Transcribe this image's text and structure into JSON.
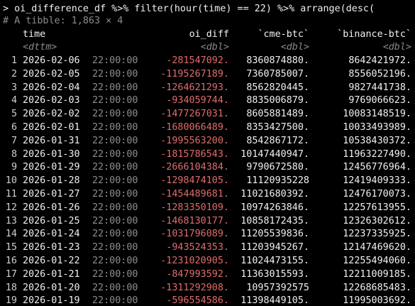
{
  "console": {
    "partial_top_line": "",
    "command": "> oi_difference_df %>% filter(hour(time) == 22) %>% arrange(desc(",
    "tibble_comment": "# A tibble: 1,863 × 4"
  },
  "table": {
    "columns": [
      "time",
      "oi_diff",
      "`cme-btc`",
      "`binance-btc`"
    ],
    "types": [
      "<dttm>",
      "<dbl>",
      "<dbl>",
      "<dbl>"
    ],
    "rows": [
      {
        "n": "1",
        "date": "2026-02-06",
        "time": "22:00:00",
        "oi_diff": "-281547092.",
        "cme": "8360874880.",
        "binance": "8642421972."
      },
      {
        "n": "2",
        "date": "2026-02-05",
        "time": "22:00:00",
        "oi_diff": "-1195267189.",
        "cme": "7360785007.",
        "binance": "8556052196."
      },
      {
        "n": "3",
        "date": "2026-02-04",
        "time": "22:00:00",
        "oi_diff": "-1264621293.",
        "cme": "8562820445.",
        "binance": "9827441738."
      },
      {
        "n": "4",
        "date": "2026-02-03",
        "time": "22:00:00",
        "oi_diff": "-934059744.",
        "cme": "8835006879.",
        "binance": "9769066623."
      },
      {
        "n": "5",
        "date": "2026-02-02",
        "time": "22:00:00",
        "oi_diff": "-1477267031.",
        "cme": "8605881489.",
        "binance": "10083148519."
      },
      {
        "n": "6",
        "date": "2026-02-01",
        "time": "22:00:00",
        "oi_diff": "-1680066489.",
        "cme": "8353427500.",
        "binance": "10033493989."
      },
      {
        "n": "7",
        "date": "2026-01-31",
        "time": "22:00:00",
        "oi_diff": "-1995563200.",
        "cme": "8542867172.",
        "binance": "10538430372."
      },
      {
        "n": "8",
        "date": "2026-01-30",
        "time": "22:00:00",
        "oi_diff": "-1815786543.",
        "cme": "10147440947.",
        "binance": "11963227490."
      },
      {
        "n": "9",
        "date": "2026-01-29",
        "time": "22:00:00",
        "oi_diff": "-2666104384.",
        "cme": "9790672580.",
        "binance": "12456776964."
      },
      {
        "n": "10",
        "date": "2026-01-28",
        "time": "22:00:00",
        "oi_diff": "-1298474105.",
        "cme": "11120935228",
        "binance": "12419409333."
      },
      {
        "n": "11",
        "date": "2026-01-27",
        "time": "22:00:00",
        "oi_diff": "-1454489681.",
        "cme": "11021680392.",
        "binance": "12476170073."
      },
      {
        "n": "12",
        "date": "2026-01-26",
        "time": "22:00:00",
        "oi_diff": "-1283350109.",
        "cme": "10974263846.",
        "binance": "12257613955."
      },
      {
        "n": "13",
        "date": "2026-01-25",
        "time": "22:00:00",
        "oi_diff": "-1468130177.",
        "cme": "10858172435.",
        "binance": "12326302612."
      },
      {
        "n": "14",
        "date": "2026-01-24",
        "time": "22:00:00",
        "oi_diff": "-1031796089.",
        "cme": "11205539836.",
        "binance": "12237335925."
      },
      {
        "n": "15",
        "date": "2026-01-23",
        "time": "22:00:00",
        "oi_diff": "-943524353.",
        "cme": "11203945267.",
        "binance": "12147469620."
      },
      {
        "n": "16",
        "date": "2026-01-22",
        "time": "22:00:00",
        "oi_diff": "-1231020905.",
        "cme": "11024473155.",
        "binance": "12255494060."
      },
      {
        "n": "17",
        "date": "2026-01-21",
        "time": "22:00:00",
        "oi_diff": "-847993592.",
        "cme": "11363015593.",
        "binance": "12211009185."
      },
      {
        "n": "18",
        "date": "2026-01-20",
        "time": "22:00:00",
        "oi_diff": "-1311292908.",
        "cme": "10957392575",
        "binance": "12268685483."
      },
      {
        "n": "19",
        "date": "2026-01-19",
        "time": "22:00:00",
        "oi_diff": "-596554586.",
        "cme": "11398449105.",
        "binance": "11995003692."
      }
    ]
  },
  "colors": {
    "background": "#000000",
    "text": "#f0f0f0",
    "negative": "#e06c6c",
    "muted": "#8c8c8c"
  }
}
